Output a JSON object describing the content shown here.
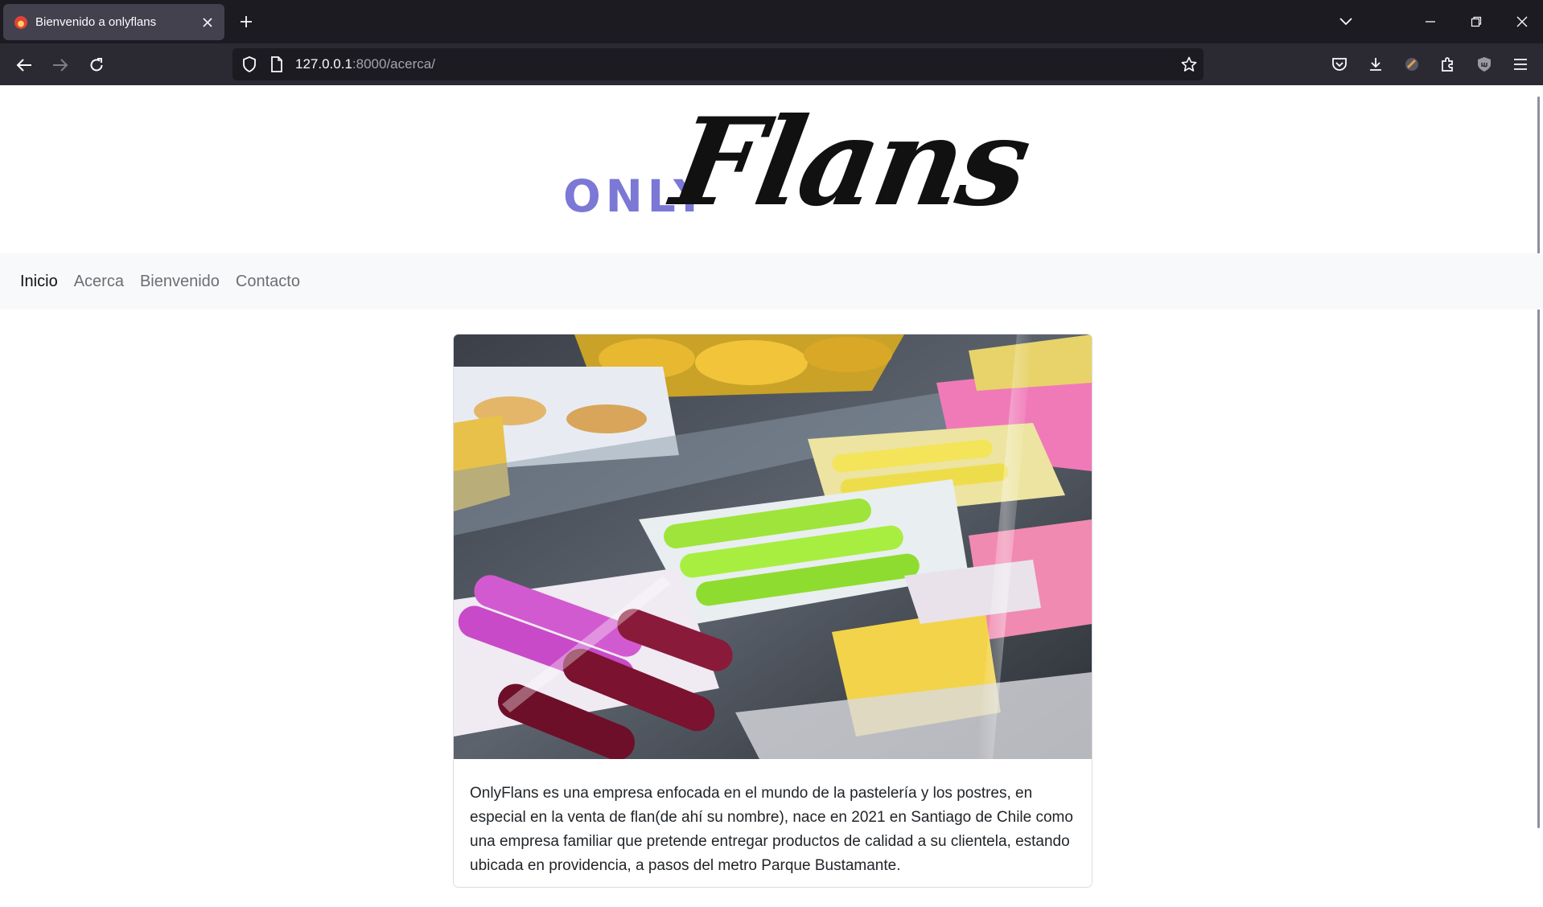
{
  "browser": {
    "tab_title": "Bienvenido a onlyflans",
    "url_host": "127.0.0.1",
    "url_rest": ":8000/acerca/"
  },
  "site": {
    "logo_prefix": "ONLY",
    "logo_name": "Flans",
    "nav": [
      {
        "label": "Inicio",
        "active": true
      },
      {
        "label": "Acerca",
        "active": false
      },
      {
        "label": "Bienvenido",
        "active": false
      },
      {
        "label": "Contacto",
        "active": false
      }
    ],
    "card_text": "OnlyFlans es una empresa enfocada en el mundo de la pastelería y los postres, en especial en la venta de flan(de ahí su nombre), nace en 2021 en Santiago de Chile como una empresa familiar que pretende entregar productos de calidad a su clientela, estando ubicada en providencia, a pasos del metro Parque Bustamante."
  },
  "colors": {
    "chrome_dark": "#1c1b22",
    "chrome_toolbar": "#2b2a33",
    "logo_accent": "#7b78d6",
    "nav_bg": "#f8f9fa"
  }
}
